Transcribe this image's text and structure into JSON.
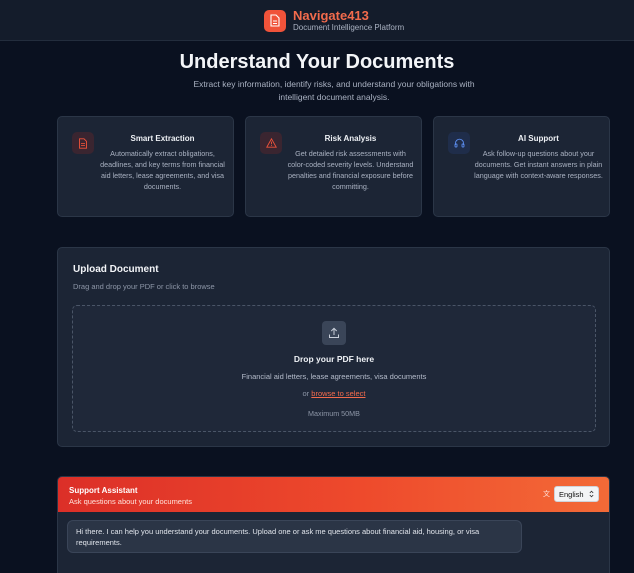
{
  "header": {
    "brand_name": "Navigate413",
    "tagline": "Document Intelligence Platform",
    "logo_icon": "document-icon"
  },
  "hero": {
    "title": "Understand Your Documents",
    "subtitle": "Extract key information, identify risks, and understand your obligations with intelligent document analysis."
  },
  "features": [
    {
      "title": "Smart Extraction",
      "description": "Automatically extract obligations, deadlines, and key terms from financial aid letters, lease agreements, and visa documents.",
      "icon": "document-icon"
    },
    {
      "title": "Risk Analysis",
      "description": "Get detailed risk assessments with color-coded severity levels. Understand penalties and financial exposure before committing.",
      "icon": "warning-triangle-icon"
    },
    {
      "title": "AI Support",
      "description": "Ask follow-up questions about your documents. Get instant answers in plain language with context-aware responses.",
      "icon": "headphones-icon"
    }
  ],
  "upload": {
    "title": "Upload Document",
    "subtitle": "Drag and drop your PDF or click to browse",
    "drop_title": "Drop your PDF here",
    "drop_desc": "Financial aid letters, lease agreements, visa documents",
    "or_text": "or",
    "browse_link": "browse to select",
    "max_size": "Maximum 50MB",
    "icon": "upload-icon"
  },
  "chat": {
    "title": "Support Assistant",
    "subtitle": "Ask questions about your documents",
    "language_selected": "English",
    "language_icon": "translate-icon",
    "message": "Hi there. I can help you understand your documents. Upload one or ask me questions about financial aid, housing, or visa requirements."
  },
  "colors": {
    "accent": "#f0533a",
    "background": "#0a1120",
    "card": "#1c2535"
  }
}
